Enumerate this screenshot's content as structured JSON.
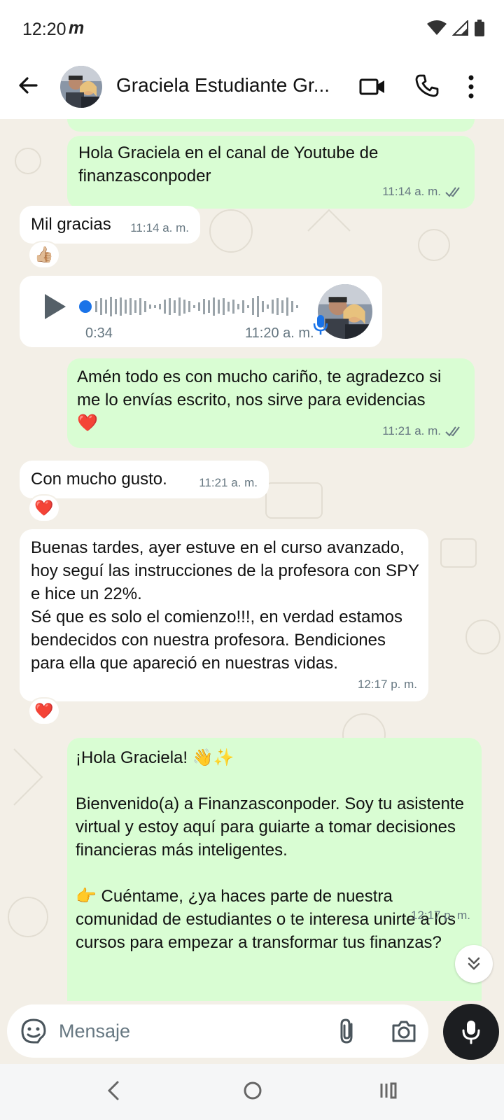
{
  "status_bar": {
    "time": "12:20",
    "carrier_icon": "m"
  },
  "header": {
    "contact_name": "Graciela Estudiante Gr..."
  },
  "messages": [
    {
      "id": "m1",
      "direction": "out",
      "text": "Hola Graciela en el canal de Youtube de finanzasconpoder",
      "time": "11:14 a. m.",
      "status": "read"
    },
    {
      "id": "m2",
      "direction": "in",
      "text": "Mil gracias",
      "time": "11:14 a. m.",
      "reaction": "👍🏼"
    },
    {
      "id": "m3",
      "direction": "in",
      "type": "voice",
      "duration": "0:34",
      "time": "11:20 a. m."
    },
    {
      "id": "m4",
      "direction": "out",
      "text": "Amén todo es con mucho cariño, te agradezco si me lo envías escrito, nos sirve para evidencias ❤️",
      "time": "11:21 a. m.",
      "status": "read"
    },
    {
      "id": "m5",
      "direction": "in",
      "text": "Con mucho gusto.",
      "time": "11:21 a. m.",
      "reaction": "❤️"
    },
    {
      "id": "m6",
      "direction": "in",
      "text": "Buenas tardes, ayer estuve en el curso avanzado, hoy seguí las instrucciones de la profesora con SPY e hice un 22%.\nSé que es solo el comienzo!!!, en verdad estamos bendecidos con nuestra profesora. Bendiciones para ella que apareció en nuestras vidas.",
      "time": "12:17 p. m.",
      "reaction": "❤️"
    },
    {
      "id": "m7",
      "direction": "out",
      "text": "¡Hola Graciela! 👋✨\n\nBienvenido(a) a Finanzasconpoder. Soy tu asistente virtual y estoy aquí para guiarte a tomar decisiones financieras más inteligentes.\n\n👉 Cuéntame, ¿ya haces parte de nuestra comunidad de estudiantes o te interesa unirte a los cursos para empezar a transformar tus finanzas?",
      "time": "12:17 p. m."
    }
  ],
  "composer": {
    "placeholder": "Mensaje"
  },
  "colors": {
    "outgoing": "#d9fdd3",
    "incoming": "#ffffff",
    "wallpaper": "#f3efe7",
    "read_tick": "#667781",
    "voice_dot": "#1a73e8"
  },
  "icons": [
    "back-arrow-icon",
    "video-call-icon",
    "phone-call-icon",
    "more-menu-icon",
    "play-icon",
    "microphone-icon",
    "sticker-icon",
    "paperclip-icon",
    "camera-icon",
    "chevron-double-down-icon"
  ]
}
